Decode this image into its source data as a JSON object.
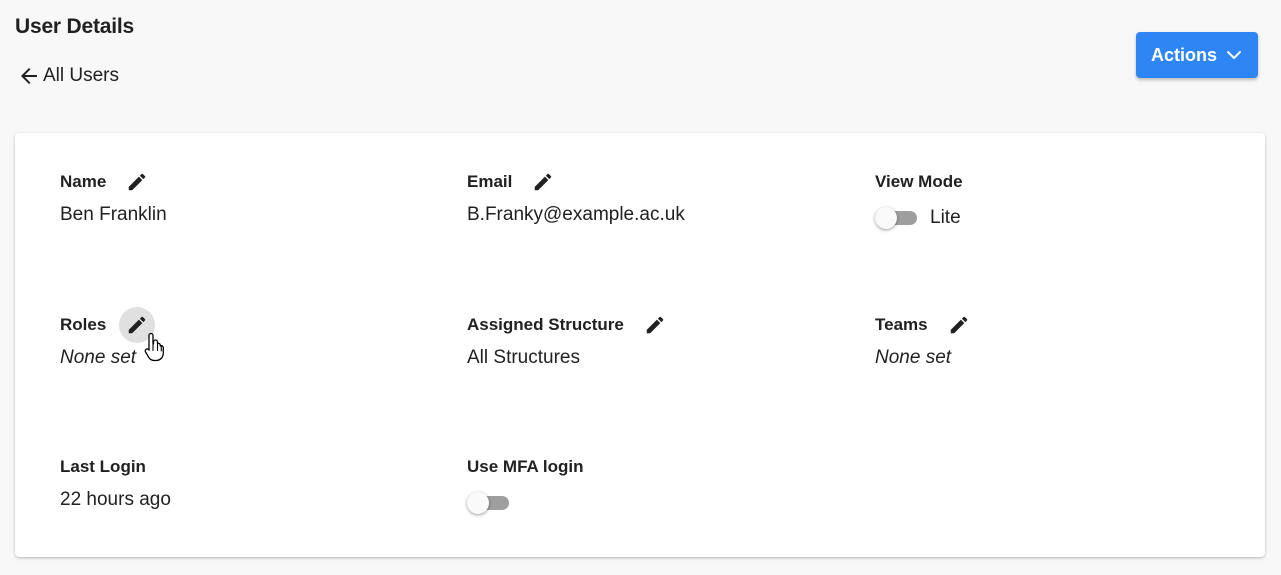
{
  "header": {
    "title": "User Details",
    "back_label": "All Users",
    "back_icon": "arrow-left-icon",
    "actions_label": "Actions",
    "actions_icon": "chevron-down-icon"
  },
  "colors": {
    "accent": "#2e86f5",
    "toggle_track": "#9e9e9e",
    "hover_circle": "#e0e0e0"
  },
  "fields": {
    "name": {
      "label": "Name",
      "value": "Ben Franklin",
      "editable": true
    },
    "email": {
      "label": "Email",
      "value": "B.Franky@example.ac.uk",
      "editable": true
    },
    "view_mode": {
      "label": "View Mode",
      "toggle_on": false,
      "toggle_label": "Lite"
    },
    "roles": {
      "label": "Roles",
      "value": "None set",
      "editable": true
    },
    "assigned_structure": {
      "label": "Assigned Structure",
      "value": "All Structures",
      "editable": true
    },
    "teams": {
      "label": "Teams",
      "value": "None set",
      "editable": true
    },
    "last_login": {
      "label": "Last Login",
      "value": "22 hours ago"
    },
    "use_mfa": {
      "label": "Use MFA login",
      "toggle_on": false
    }
  }
}
